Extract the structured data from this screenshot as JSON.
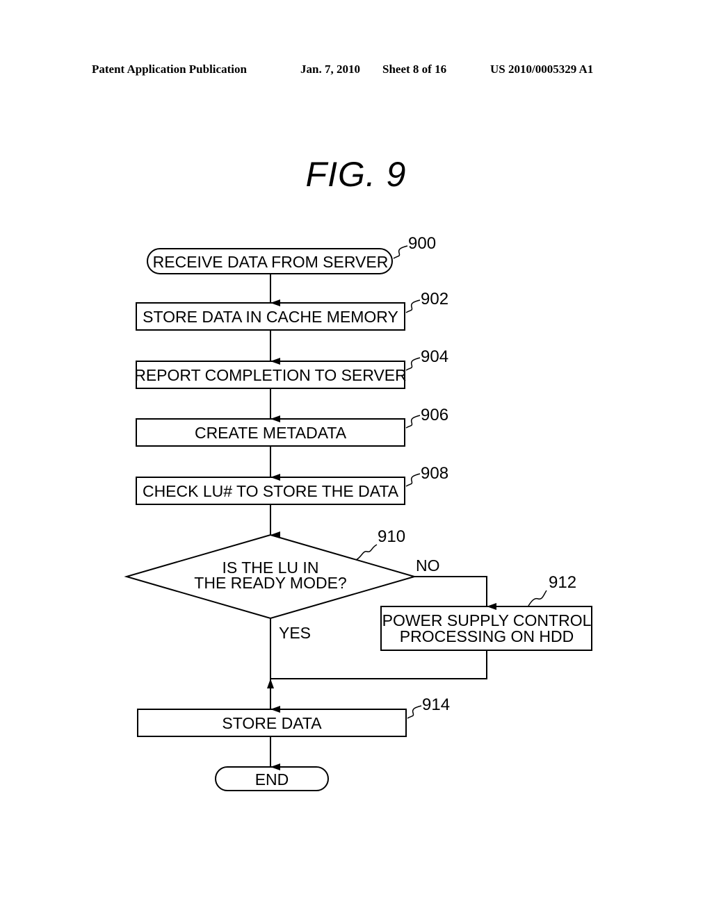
{
  "header": {
    "publication": "Patent Application Publication",
    "date": "Jan. 7, 2010",
    "sheet": "Sheet 8 of 16",
    "number": "US 2010/0005329 A1"
  },
  "figure": {
    "title": "FIG.  9"
  },
  "flowchart": {
    "nodes": [
      {
        "id": "900",
        "type": "terminal",
        "lines": [
          "RECEIVE DATA FROM SERVER"
        ]
      },
      {
        "id": "902",
        "type": "process",
        "lines": [
          "STORE DATA IN CACHE MEMORY"
        ]
      },
      {
        "id": "904",
        "type": "process",
        "lines": [
          "REPORT COMPLETION TO SERVER"
        ]
      },
      {
        "id": "906",
        "type": "process",
        "lines": [
          "CREATE METADATA"
        ]
      },
      {
        "id": "908",
        "type": "process",
        "lines": [
          "CHECK LU# TO STORE THE DATA"
        ]
      },
      {
        "id": "910",
        "type": "decision",
        "lines": [
          "IS THE LU IN",
          "THE READY MODE?"
        ]
      },
      {
        "id": "912",
        "type": "process",
        "lines": [
          "POWER SUPPLY CONTROL",
          "PROCESSING ON HDD"
        ]
      },
      {
        "id": "914",
        "type": "process",
        "lines": [
          "STORE DATA"
        ]
      },
      {
        "id": "end",
        "type": "terminal",
        "lines": [
          "END"
        ]
      }
    ],
    "branches": {
      "no": "NO",
      "yes": "YES"
    }
  }
}
